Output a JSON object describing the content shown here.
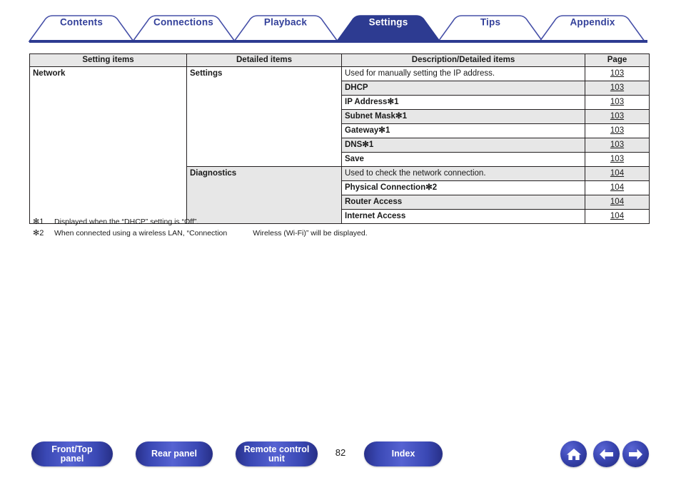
{
  "tabs": [
    {
      "label": "Contents",
      "active": false
    },
    {
      "label": "Connections",
      "active": false
    },
    {
      "label": "Playback",
      "active": false
    },
    {
      "label": "Settings",
      "active": true
    },
    {
      "label": "Tips",
      "active": false
    },
    {
      "label": "Appendix",
      "active": false
    }
  ],
  "table": {
    "headers": [
      "Setting items",
      "Detailed items",
      "Description/Detailed items",
      "Page"
    ],
    "group": "Network",
    "rows": [
      {
        "detailed": "Settings",
        "description": "Used for manually setting the IP address.",
        "page": "103",
        "bold_desc": false,
        "shaded": false,
        "detailed_rowspan": 7
      },
      {
        "detailed": "",
        "description": "DHCP",
        "page": "103",
        "bold_desc": true,
        "shaded": true
      },
      {
        "detailed": "",
        "description": "IP Address✻1",
        "page": "103",
        "bold_desc": true,
        "shaded": false
      },
      {
        "detailed": "",
        "description": "Subnet Mask✻1",
        "page": "103",
        "bold_desc": true,
        "shaded": true
      },
      {
        "detailed": "",
        "description": "Gateway✻1",
        "page": "103",
        "bold_desc": true,
        "shaded": false
      },
      {
        "detailed": "",
        "description": "DNS✻1",
        "page": "103",
        "bold_desc": true,
        "shaded": true
      },
      {
        "detailed": "",
        "description": "Save",
        "page": "103",
        "bold_desc": true,
        "shaded": false
      },
      {
        "detailed": "Diagnostics",
        "description": "Used to check the network connection.",
        "page": "104",
        "bold_desc": false,
        "shaded": true,
        "detailed_rowspan": 4
      },
      {
        "detailed": "",
        "description": "Physical Connection✻2",
        "page": "104",
        "bold_desc": true,
        "shaded": false
      },
      {
        "detailed": "",
        "description": "Router Access",
        "page": "104",
        "bold_desc": true,
        "shaded": true
      },
      {
        "detailed": "",
        "description": "Internet Access",
        "page": "104",
        "bold_desc": true,
        "shaded": false
      }
    ]
  },
  "footnotes": [
    {
      "mark": "✻1",
      "text": "Displayed when the “DHCP” setting is “Off”."
    },
    {
      "mark": "✻2",
      "text_before": "When connected using a wireless LAN, “Connection",
      "text_after": "Wireless (Wi-Fi)” will be displayed."
    }
  ],
  "bottom": {
    "front_panel": {
      "line1": "Front/Top",
      "line2": "panel"
    },
    "rear_panel": {
      "line1": "Rear panel",
      "line2": ""
    },
    "remote": {
      "line1": "Remote control",
      "line2": "unit"
    },
    "index": {
      "line1": "Index",
      "line2": ""
    },
    "page_number": "82",
    "icons": {
      "home": "home-icon",
      "prev": "arrow-left-icon",
      "next": "arrow-right-icon"
    }
  },
  "colors": {
    "brand_blue": "#33409a",
    "active_tab_fill": "#2d3b91",
    "header_shade": "#e7e7e7",
    "border": "#231f20"
  }
}
